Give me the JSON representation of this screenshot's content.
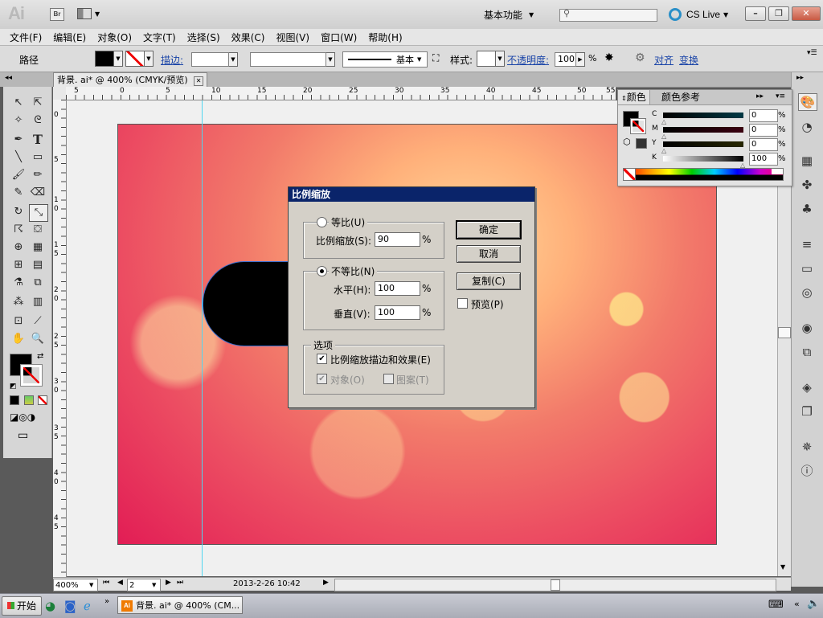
{
  "appbar": {
    "logo": "Ai",
    "bridge": "Br",
    "workspace": "基本功能",
    "cslive": "CS Live"
  },
  "menubar": [
    "文件(F)",
    "编辑(E)",
    "对象(O)",
    "文字(T)",
    "选择(S)",
    "效果(C)",
    "视图(V)",
    "窗口(W)",
    "帮助(H)"
  ],
  "control": {
    "selection_type": "路径",
    "stroke_label": "描边:",
    "stroke_profile": "基本",
    "style_label": "样式:",
    "opacity_label": "不透明度:",
    "opacity_value": "100",
    "opacity_unit": "%",
    "align_link": "对齐",
    "transform_link": "变换"
  },
  "document": {
    "tab_title": "背景. ai* @ 400% (CMYK/预览)",
    "zoom": "400%",
    "page": "2",
    "status_date": "2013-2-26  10:42"
  },
  "ruler_h": [
    "5",
    "0",
    "5",
    "10",
    "15",
    "20",
    "25",
    "30",
    "35",
    "40",
    "45",
    "50",
    "55"
  ],
  "ruler_v": [
    "0",
    "5",
    "1 0",
    "1 5",
    "2 0",
    "2 5",
    "3 0",
    "3 5",
    "4 0",
    "4 5"
  ],
  "color_panel": {
    "tab_color": "颜色",
    "tab_guide": "颜色参考",
    "channels": [
      {
        "label": "C",
        "value": "0",
        "unit": "%"
      },
      {
        "label": "M",
        "value": "0",
        "unit": "%"
      },
      {
        "label": "Y",
        "value": "0",
        "unit": "%"
      },
      {
        "label": "K",
        "value": "100",
        "unit": "%"
      }
    ]
  },
  "dialog": {
    "title": "比例缩放",
    "uniform_label": "等比(U)",
    "scale_label": "比例缩放(S):",
    "scale_value": "90",
    "pct": "%",
    "nonuniform_label": "不等比(N)",
    "horizontal_label": "水平(H):",
    "horizontal_value": "100",
    "vertical_label": "垂直(V):",
    "vertical_value": "100",
    "options_label": "选项",
    "scale_strokes_label": "比例缩放描边和效果(E)",
    "objects_label": "对象(O)",
    "patterns_label": "图案(T)",
    "ok": "确定",
    "cancel": "取消",
    "copy": "复制(C)",
    "preview": "预览(P)"
  },
  "taskbar": {
    "start": "开始",
    "task": "背景. ai* @ 400% (CM..."
  },
  "colors": {
    "dialog_title_bg": "#0a246a",
    "link": "#1b45a8",
    "guide": "#4fd6f0",
    "artboard_edge": "#e21d55"
  }
}
